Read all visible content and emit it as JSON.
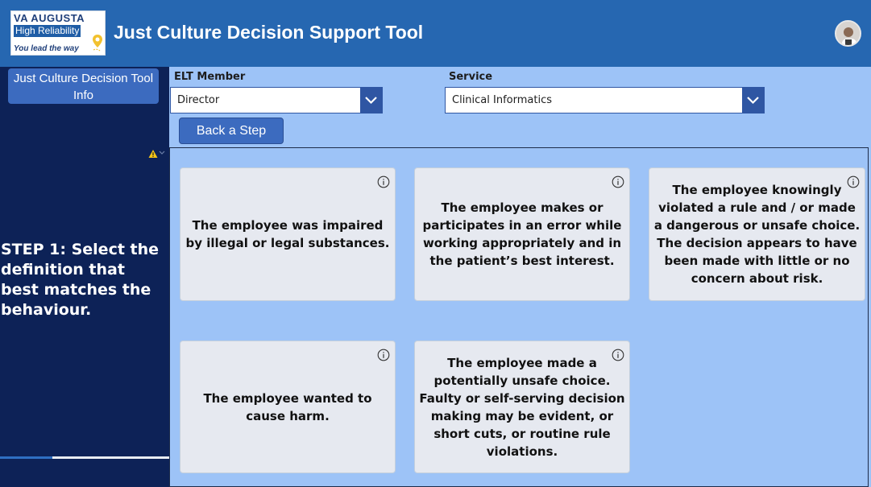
{
  "header": {
    "logo": {
      "line1": "VA AUGUSTA",
      "line2": "High Reliability",
      "line3": "You lead the way"
    },
    "title": "Just Culture Decision Support Tool",
    "avatar_icon": "user-avatar"
  },
  "sidebar": {
    "info_button": "Just Culture Decision Tool Info",
    "step_text": "STEP 1: Select the definition that best matches the behaviour.",
    "warning_icon": "warning-icon",
    "progress_percent": 31
  },
  "filters": {
    "elt": {
      "label": "ELT Member",
      "value": "Director"
    },
    "service": {
      "label": "Service",
      "value": "Clinical Informatics"
    }
  },
  "back_button": "Back a Step",
  "cards": [
    "The employee was impaired by illegal or legal substances.",
    "The employee makes or participates in an error while working appropriately and in the patient’s best interest.",
    "The employee knowingly violated a rule and / or made a dangerous or unsafe choice. The decision appears to have been made with little or no concern about risk.",
    "The employee wanted to cause harm.",
    "The employee made a potentially unsafe choice. Faulty or self-serving decision making may be evident, or short cuts, or routine rule violations."
  ],
  "colors": {
    "header": "#2667b1",
    "sidebar": "#0d2257",
    "background": "#9dc3f7",
    "card": "#e6e9f0",
    "button": "#3c6bbf"
  }
}
